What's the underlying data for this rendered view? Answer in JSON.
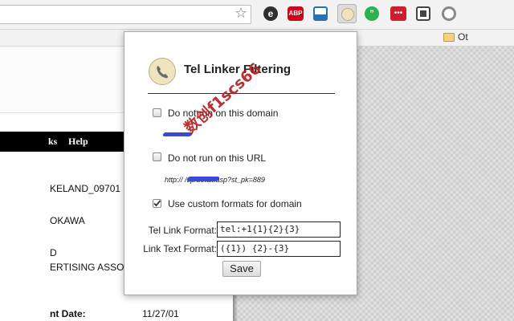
{
  "browser": {
    "bookmarks_folder": "Ot",
    "extensions": [
      {
        "icon": "e-extension-icon",
        "color": "#2f2f2f"
      },
      {
        "icon": "adblock-plus-icon",
        "color": "#d0021b",
        "text": "ABP"
      },
      {
        "icon": "window-extension-icon",
        "color": "#2a6fb3"
      },
      {
        "icon": "tel-linker-icon",
        "color": "#efe4bd"
      },
      {
        "icon": "hangouts-icon",
        "color": "#2bb24c"
      },
      {
        "icon": "dots-extension-icon",
        "color": "#cc1f2a"
      },
      {
        "icon": "qr-code-icon",
        "color": "#444444"
      },
      {
        "icon": "power-extension-icon",
        "color": "#777777"
      }
    ]
  },
  "page": {
    "nav_items": [
      "ks",
      "Help"
    ],
    "lines": [
      "KELAND_09701",
      "OKAWA",
      "D",
      "ERTISING ASSOCI",
      "nt Date:",
      "11/27/01"
    ]
  },
  "popup": {
    "title": "Tel Linker Filtering",
    "options": [
      {
        "label": "Do not run on this domain",
        "checked": false
      },
      {
        "label": "Do not run on this URL",
        "checked": false
      },
      {
        "label": "Use custom formats for domain",
        "checked": true
      }
    ],
    "url_text": "http://                 /sp/detail.asp?st_pk=889",
    "tel_link_format_label": "Tel Link Format:",
    "tel_link_format_value": "tel:+1{1}{2}{3}",
    "link_text_format_label": "Link Text Format:",
    "link_text_format_value": "({1}) {2}-{3}",
    "save_label": "Save"
  },
  "watermark": "数创f1scs66"
}
